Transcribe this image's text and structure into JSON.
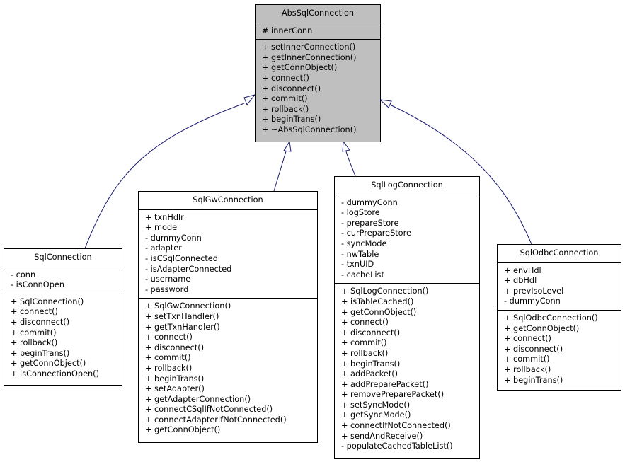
{
  "diagram": {
    "type": "uml-class-diagram",
    "relation": "inheritance",
    "colors": {
      "base_fill": "#bfbfbf",
      "derived_fill": "#ffffff",
      "border": "#000000",
      "edge": "#191970"
    },
    "base": {
      "name": "AbsSqlConnection",
      "attributes": [
        "# innerConn"
      ],
      "operations": [
        "+ setInnerConnection()",
        "+ getInnerConnection()",
        "+ getConnObject()",
        "+ connect()",
        "+ disconnect()",
        "+ commit()",
        "+ rollback()",
        "+ beginTrans()",
        "+ ~AbsSqlConnection()"
      ]
    },
    "derived": [
      {
        "name": "SqlConnection",
        "attributes": [
          "- conn",
          "- isConnOpen"
        ],
        "operations": [
          "+ SqlConnection()",
          "+ connect()",
          "+ disconnect()",
          "+ commit()",
          "+ rollback()",
          "+ beginTrans()",
          "+ getConnObject()",
          "+ isConnectionOpen()"
        ]
      },
      {
        "name": "SqlGwConnection",
        "attributes": [
          "+ txnHdlr",
          "+ mode",
          "- dummyConn",
          "- adapter",
          "- isCSqlConnected",
          "- isAdapterConnected",
          "- username",
          "- password"
        ],
        "operations": [
          "+ SqlGwConnection()",
          "+ setTxnHandler()",
          "+ getTxnHandler()",
          "+ connect()",
          "+ disconnect()",
          "+ commit()",
          "+ rollback()",
          "+ beginTrans()",
          "+ setAdapter()",
          "+ getAdapterConnection()",
          "+ connectCSqlIfNotConnected()",
          "+ connectAdapterIfNotConnected()",
          "+ getConnObject()"
        ]
      },
      {
        "name": "SqlLogConnection",
        "attributes": [
          "- dummyConn",
          "- logStore",
          "- prepareStore",
          "- curPrepareStore",
          "- syncMode",
          "- nwTable",
          "- txnUID",
          "- cacheList"
        ],
        "operations": [
          "+ SqlLogConnection()",
          "+ isTableCached()",
          "+ getConnObject()",
          "+ connect()",
          "+ disconnect()",
          "+ commit()",
          "+ rollback()",
          "+ beginTrans()",
          "+ addPacket()",
          "+ addPreparePacket()",
          "+ removePreparePacket()",
          "+ setSyncMode()",
          "+ getSyncMode()",
          "+ connectIfNotConnected()",
          "+ sendAndReceive()",
          "- populateCachedTableList()"
        ]
      },
      {
        "name": "SqlOdbcConnection",
        "attributes": [
          "+ envHdl",
          "+ dbHdl",
          "+ prevIsoLevel",
          "- dummyConn"
        ],
        "operations": [
          "+ SqlOdbcConnection()",
          "+ getConnObject()",
          "+ connect()",
          "+ disconnect()",
          "+ commit()",
          "+ rollback()",
          "+ beginTrans()"
        ]
      }
    ],
    "edges": [
      {
        "from": "SqlConnection",
        "to": "AbsSqlConnection"
      },
      {
        "from": "SqlGwConnection",
        "to": "AbsSqlConnection"
      },
      {
        "from": "SqlLogConnection",
        "to": "AbsSqlConnection"
      },
      {
        "from": "SqlOdbcConnection",
        "to": "AbsSqlConnection"
      }
    ]
  }
}
